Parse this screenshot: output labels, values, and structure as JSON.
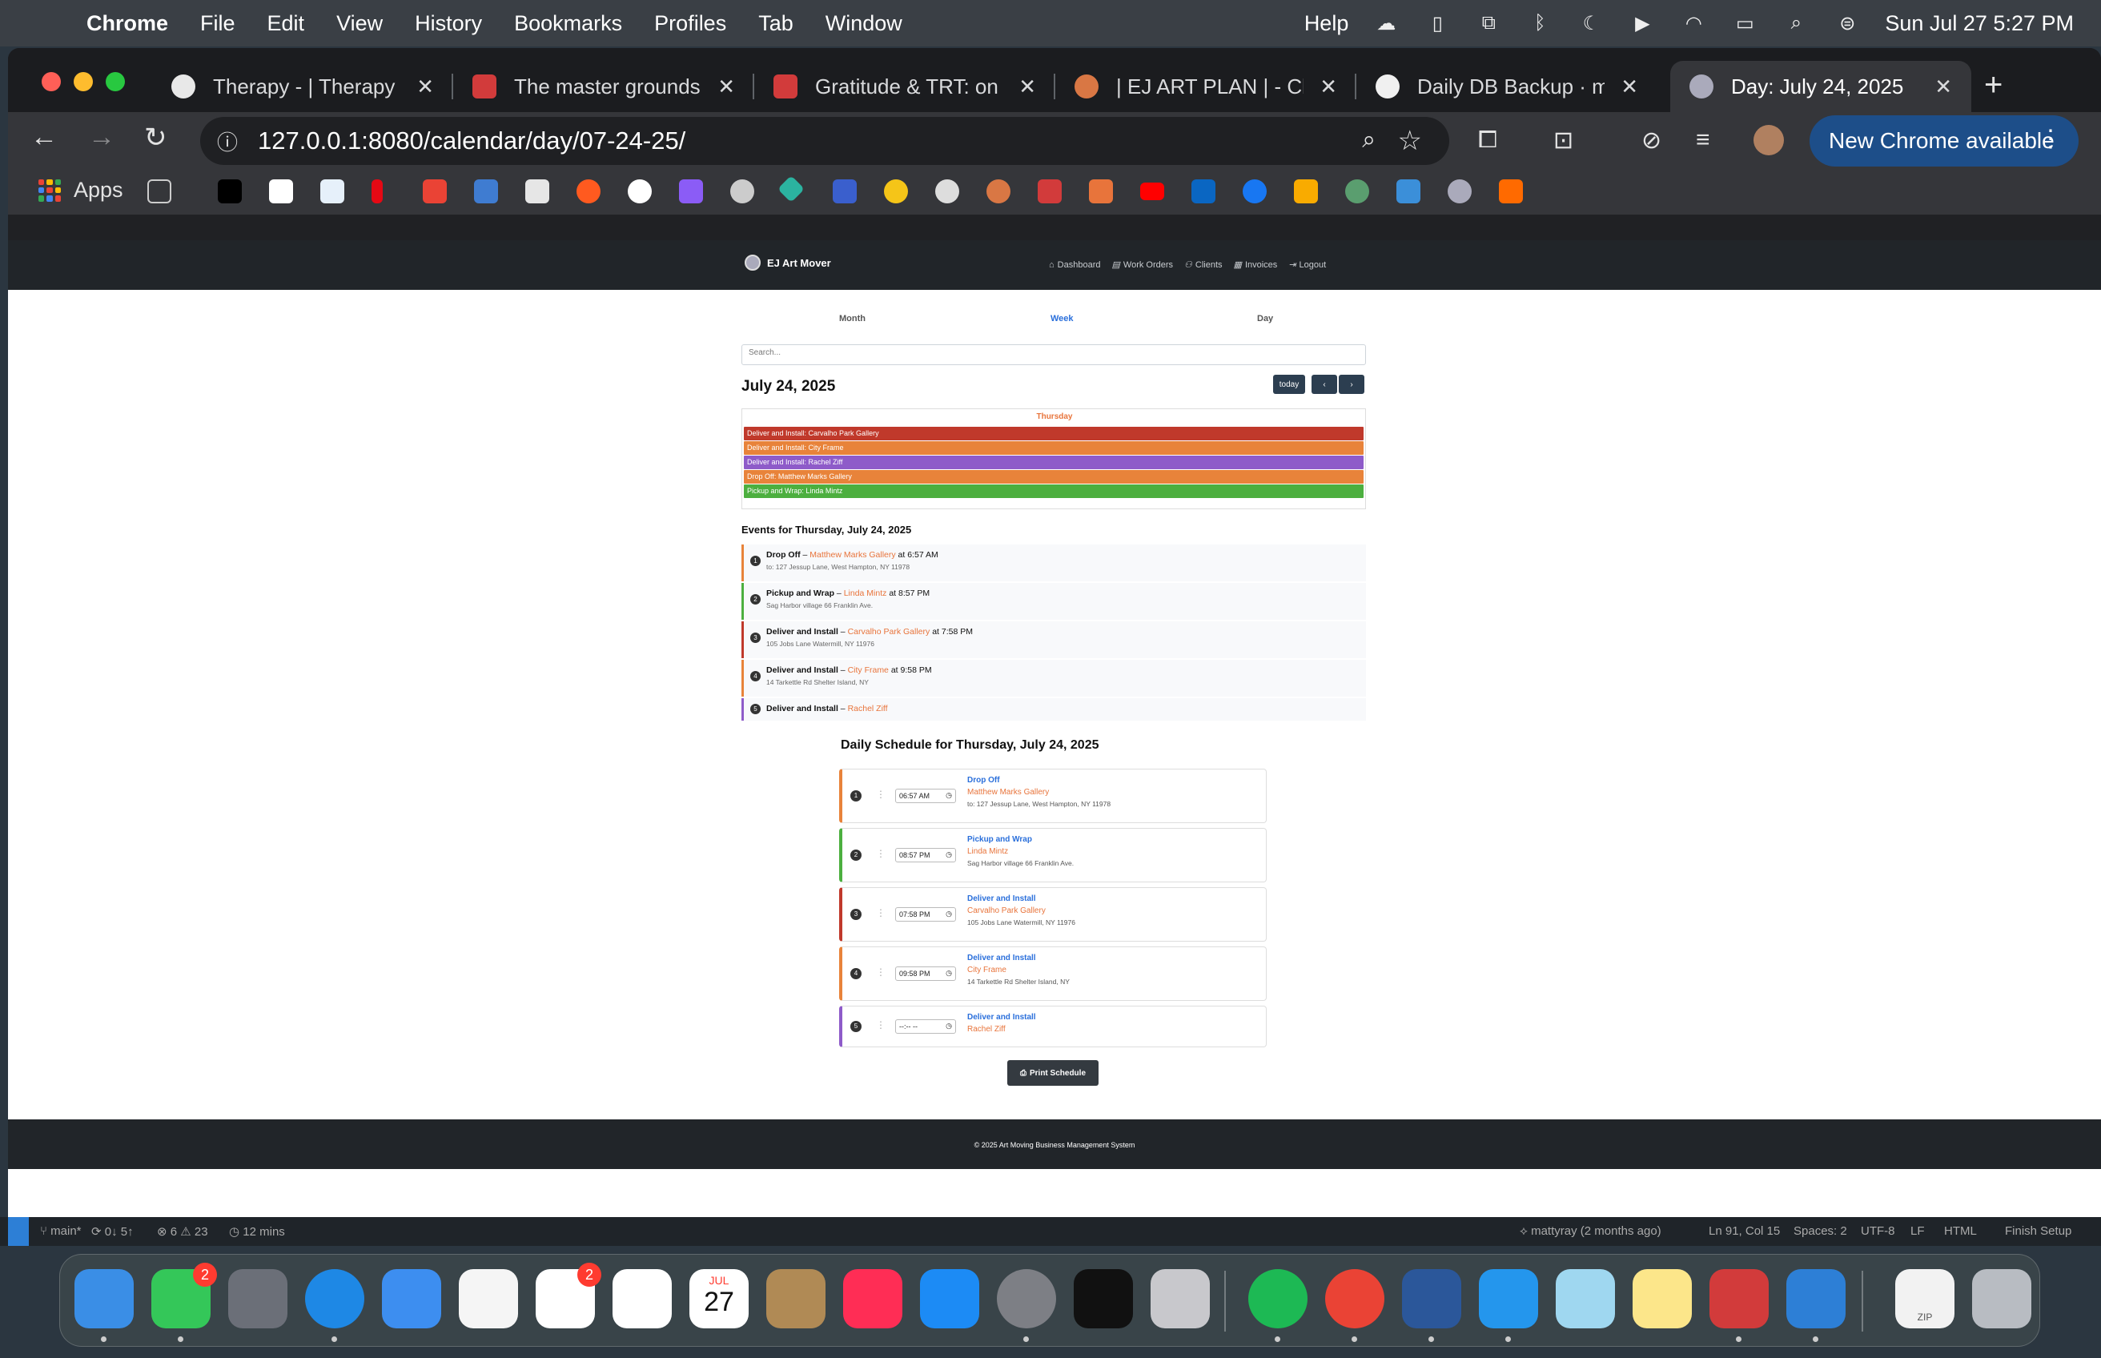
{
  "menubar": {
    "app": "Chrome",
    "items": [
      "File",
      "Edit",
      "View",
      "History",
      "Bookmarks",
      "Profiles",
      "Tab",
      "Window"
    ],
    "help": "Help",
    "clock": "Sun Jul 27  5:27 PM"
  },
  "tabs": [
    {
      "title": "Therapy - | Therapy V",
      "active": false
    },
    {
      "title": "The master grounds a",
      "active": false
    },
    {
      "title": "Gratitude & TRT: on Li",
      "active": false
    },
    {
      "title": "| EJ ART PLAN | - Cla",
      "active": false
    },
    {
      "title": "Daily DB Backup · ma",
      "active": false
    },
    {
      "title": "Day: July 24, 2025",
      "active": true
    }
  ],
  "address": {
    "url": "127.0.0.1:8080/calendar/day/07-24-25/"
  },
  "new_chrome": "New Chrome available",
  "bookmarks": {
    "apps_label": "Apps"
  },
  "site": {
    "brand": "EJ Art Mover",
    "nav": [
      "Dashboard",
      "Work Orders",
      "Clients",
      "Invoices",
      "Logout"
    ],
    "view_tabs": [
      "Month",
      "Week",
      "Day"
    ],
    "active_view": "Week",
    "search_placeholder": "Search...",
    "date_title": "July 24, 2025",
    "today_btn": "today",
    "prev_btn": "‹",
    "next_btn": "›",
    "calendar": {
      "day_label": "Thursday",
      "events": [
        {
          "label": "Deliver and Install: Carvalho Park Gallery",
          "color": "#c0392b"
        },
        {
          "label": "Deliver and Install: City Frame",
          "color": "#e8833a"
        },
        {
          "label": "Deliver and Install: Rachel Ziff",
          "color": "#8e5bc9"
        },
        {
          "label": "Drop Off: Matthew Marks Gallery",
          "color": "#e8833a"
        },
        {
          "label": "Pickup and Wrap: Linda Mintz",
          "color": "#4caf3f"
        }
      ]
    },
    "events_heading": "Events for Thursday, July 24, 2025",
    "events_list": [
      {
        "num": "1",
        "service": "Drop Off",
        "client": "Matthew Marks Gallery",
        "time": "at 6:57 AM",
        "address": "to: 127 Jessup Lane, West Hampton, NY 11978",
        "color": "#e8833a"
      },
      {
        "num": "2",
        "service": "Pickup and Wrap",
        "client": "Linda Mintz",
        "time": "at 8:57 PM",
        "address": "Sag Harbor village 66 Franklin Ave.",
        "color": "#4caf3f"
      },
      {
        "num": "3",
        "service": "Deliver and Install",
        "client": "Carvalho Park Gallery",
        "time": "at 7:58 PM",
        "address": "105 Jobs Lane Watermill, NY 11976",
        "color": "#c0392b"
      },
      {
        "num": "4",
        "service": "Deliver and Install",
        "client": "City Frame",
        "time": "at 9:58 PM",
        "address": "14 Tarkettle Rd Shelter Island, NY",
        "color": "#e8833a"
      },
      {
        "num": "5",
        "service": "Deliver and Install",
        "client": "Rachel Ziff",
        "time": "",
        "address": "",
        "color": "#8e5bc9"
      }
    ],
    "schedule_heading": "Daily Schedule for Thursday, July 24, 2025",
    "schedule": [
      {
        "num": "1",
        "time": "06:57 AM",
        "service": "Drop Off",
        "client": "Matthew Marks Gallery",
        "address": "to: 127 Jessup Lane, West Hampton, NY 11978",
        "color": "#e8833a"
      },
      {
        "num": "2",
        "time": "08:57 PM",
        "service": "Pickup and Wrap",
        "client": "Linda Mintz",
        "address": "Sag Harbor village 66 Franklin Ave.",
        "color": "#4caf3f"
      },
      {
        "num": "3",
        "time": "07:58 PM",
        "service": "Deliver and Install",
        "client": "Carvalho Park Gallery",
        "address": "105 Jobs Lane Watermill, NY 11976",
        "color": "#c0392b"
      },
      {
        "num": "4",
        "time": "09:58 PM",
        "service": "Deliver and Install",
        "client": "City Frame",
        "address": "14 Tarkettle Rd Shelter Island, NY",
        "color": "#e8833a"
      },
      {
        "num": "5",
        "time": "--:-- --",
        "service": "Deliver and Install",
        "client": "Rachel Ziff",
        "address": "",
        "color": "#8e5bc9"
      }
    ],
    "print_btn": "Print Schedule",
    "footer": "© 2025 Art Moving Business Management System"
  },
  "vscode_status": {
    "branch": "main*",
    "sync": "0↓ 5↑",
    "problems": "⊗ 6 ⚠ 23",
    "time": "12 mins",
    "blame": "mattyray (2 months ago)",
    "position": "Ln 91, Col 15",
    "spaces": "Spaces: 2",
    "encoding": "UTF-8",
    "eol": "LF",
    "lang": "HTML",
    "finish": "Finish Setup"
  },
  "dock": {
    "calendar_month": "JUL",
    "calendar_day": "27",
    "messages_badge": "2",
    "reminders_badge": "2",
    "zip_label": "ZIP"
  }
}
